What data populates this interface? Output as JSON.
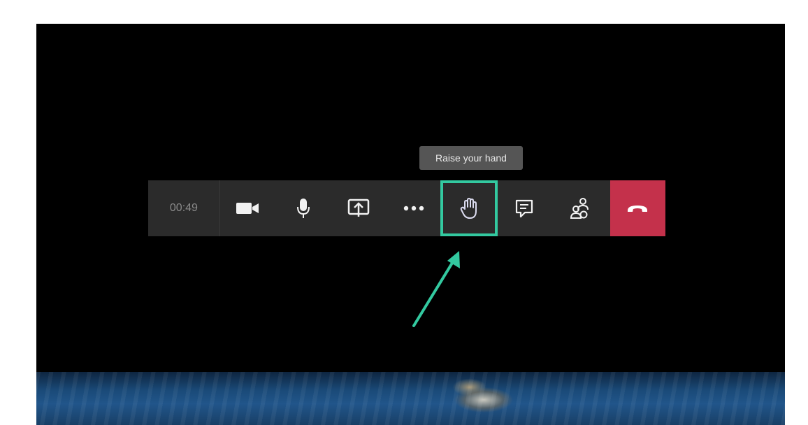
{
  "toolbar": {
    "timer": "00:49",
    "tooltip": "Raise your hand",
    "buttons": [
      {
        "name": "camera",
        "icon": "video-camera-icon"
      },
      {
        "name": "microphone",
        "icon": "microphone-icon"
      },
      {
        "name": "share",
        "icon": "share-screen-icon"
      },
      {
        "name": "more",
        "icon": "more-options-icon"
      },
      {
        "name": "raise-hand",
        "icon": "raise-hand-icon"
      },
      {
        "name": "chat",
        "icon": "chat-icon"
      },
      {
        "name": "participants",
        "icon": "participants-icon"
      },
      {
        "name": "hang-up",
        "icon": "hang-up-icon"
      }
    ]
  },
  "colors": {
    "toolbar_bg": "#2b2b2b",
    "highlight": "#33c9a0",
    "hangup": "#c4314b",
    "arrow": "#33c9a0"
  }
}
